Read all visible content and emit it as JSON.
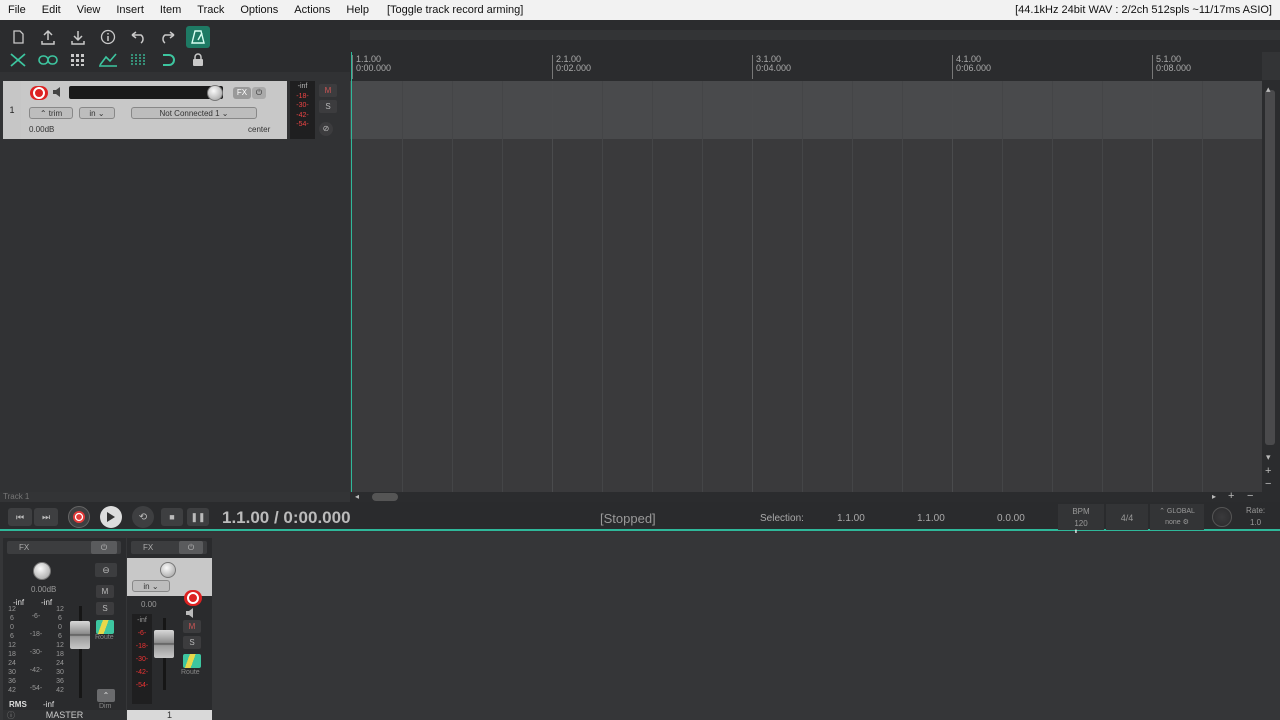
{
  "menubar": {
    "items": [
      "File",
      "Edit",
      "View",
      "Insert",
      "Item",
      "Track",
      "Options",
      "Actions",
      "Help"
    ],
    "action_hint": "[Toggle track record arming]",
    "status": "[44.1kHz 24bit WAV : 2/2ch 512spls ~11/17ms ASIO]"
  },
  "toolbar": {
    "icons": [
      "new-project-icon",
      "open-project-icon",
      "save-project-icon",
      "info-icon",
      "undo-icon",
      "redo-icon",
      "metronome-icon",
      "ripple-edit-icon",
      "link-icon",
      "grid-icon",
      "snap-icon",
      "loop-icon",
      "lock-icon"
    ],
    "accent_color": "#2fb89a"
  },
  "track1": {
    "number": "1",
    "trim_label": "trim",
    "in_label": "in",
    "input_label": "Not Connected 1",
    "volume": "0.00dB",
    "pan": "center",
    "fx_label": "FX",
    "meter_labels": [
      "-inf",
      "-18-",
      "-30-",
      "-42-",
      "-54-"
    ],
    "mute_label": "M",
    "solo_label": "S"
  },
  "ruler": {
    "marks": [
      {
        "bar": "1.1.00",
        "time": "0:00.000"
      },
      {
        "bar": "2.1.00",
        "time": "0:02.000"
      },
      {
        "bar": "3.1.00",
        "time": "0:04.000"
      },
      {
        "bar": "4.1.00",
        "time": "0:06.000"
      },
      {
        "bar": "5.1.00",
        "time": "0:08.000"
      }
    ]
  },
  "status_track": "Track 1",
  "transport": {
    "time": "1.1.00 / 0:00.000",
    "state": "[Stopped]",
    "selection_label": "Selection:",
    "selection_start": "1.1.00",
    "selection_end": "1.1.00",
    "selection_length": "0.0.00",
    "bpm_label": "BPM",
    "bpm_value": "120",
    "time_signature": "4/4",
    "global_label": "GLOBAL",
    "global_value": "none",
    "rate_label": "Rate:",
    "rate_value": "1.0"
  },
  "mixer": {
    "master": {
      "fx_label": "FX",
      "volume": "0.00dB",
      "left_peak": "-inf",
      "right_peak": "-inf",
      "scale_left": [
        "12",
        "6",
        "0",
        "6",
        "12",
        "18",
        "24",
        "30",
        "36",
        "42"
      ],
      "scale_mid": [
        "-6-",
        "-18-",
        "-30-",
        "-42-",
        "-54-"
      ],
      "scale_right": [
        "12",
        "6",
        "0",
        "6",
        "12",
        "18",
        "24",
        "30",
        "36",
        "42"
      ],
      "mute_label": "M",
      "solo_label": "S",
      "route_label": "Route",
      "dim_label": "Dim",
      "rms_label": "RMS",
      "rms_value": "-inf",
      "name": "MASTER"
    },
    "track": {
      "fx_label": "FX",
      "in_label": "in",
      "volume": "0.00",
      "meter_top": "-inf",
      "meter_labels": [
        "-6-",
        "-18-",
        "-30-",
        "-42-",
        "-54-"
      ],
      "mute_label": "M",
      "solo_label": "S",
      "route_label": "Route",
      "number": "1"
    }
  }
}
